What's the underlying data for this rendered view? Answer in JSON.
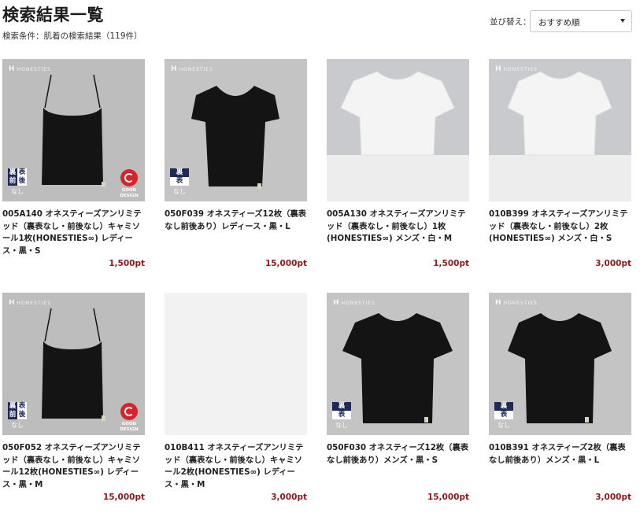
{
  "header": {
    "title": "検索結果一覧",
    "condition": "検索条件：肌着の検索結果（119件）"
  },
  "sort": {
    "label": "並び替え：",
    "selected": "おすすめ順"
  },
  "brand_mark": "HONESTIES",
  "good_design_label": "GOOD DESIGN",
  "products": [
    {
      "name": "005A140 オネスティーズアンリミテッド（裏表なし・前後なし）キャミソール1枚(HONESTIES∞) レディース・黒・S",
      "price": "1,500pt",
      "badge": [
        "裏",
        "表",
        "前",
        "後"
      ],
      "badge_note": "なし",
      "good_design": true
    },
    {
      "name": "050F039 オネスティーズ12枚（裏表なし前後あり）レディース・黒・L",
      "price": "15,000pt",
      "badge": [
        "裏",
        "表"
      ],
      "badge_note": "なし",
      "good_design": false
    },
    {
      "name": "005A130 オネスティーズアンリミテッド（裏表なし・前後なし）1枚(HONESTIES∞) メンズ・白・M",
      "price": "1,500pt"
    },
    {
      "name": "010B399 オネスティーズアンリミテッド（裏表なし・前後なし）2枚(HONESTIES∞) メンズ・白・S",
      "price": "3,000pt"
    },
    {
      "name": "050F052 オネスティーズアンリミテッド（裏表なし・前後なし）キャミソール12枚(HONESTIES∞) レディース・黒・M",
      "price": "15,000pt",
      "badge": [
        "裏",
        "表",
        "前",
        "後"
      ],
      "badge_note": "なし",
      "good_design": true
    },
    {
      "name": "010B411 オネスティーズアンリミテッド（裏表なし・前後なし）キャミソール2枚(HONESTIES∞) レディース・黒・M",
      "price": "3,000pt"
    },
    {
      "name": "050F030 オネスティーズ12枚（裏表なし前後あり）メンズ・黒・S",
      "price": "15,000pt",
      "badge": [
        "裏",
        "表"
      ],
      "badge_note": "なし"
    },
    {
      "name": "010B391 オネスティーズ2枚（裏表なし前後あり）メンズ・黒・L",
      "price": "3,000pt",
      "badge": [
        "裏",
        "表"
      ],
      "badge_note": "なし"
    }
  ],
  "colors": {
    "price": "#8b1a1a",
    "badge_navy": "#1f2a5c",
    "good_design_red": "#d8232a"
  }
}
